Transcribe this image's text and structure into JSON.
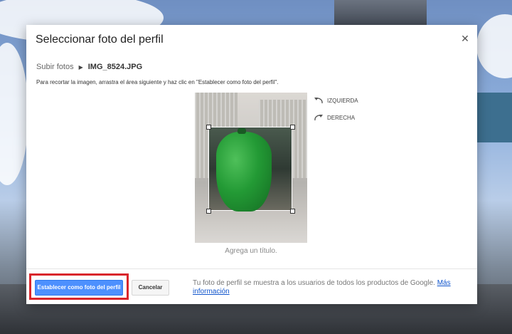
{
  "dialog": {
    "title": "Seleccionar foto del perfil",
    "close_icon": "close-icon"
  },
  "breadcrumb": {
    "parent": "Subir fotos",
    "file": "IMG_8524.JPG"
  },
  "instructions": "Para recortar la imagen, arrastra el área siguiente y haz clic en \"Establecer como foto del perfil\".",
  "rotate": {
    "left_label": "IZQUIERDA",
    "right_label": "DERECHA"
  },
  "caption_placeholder": "Agrega un título.",
  "footer": {
    "set_button": "Establecer como foto del perfil",
    "cancel_button": "Cancelar",
    "note": "Tu foto de perfil se muestra a los usuarios de todos los productos de Google.",
    "note_link": "Más información"
  },
  "colors": {
    "primary": "#4d90fe",
    "highlight": "#d9262c",
    "link": "#1155cc"
  }
}
